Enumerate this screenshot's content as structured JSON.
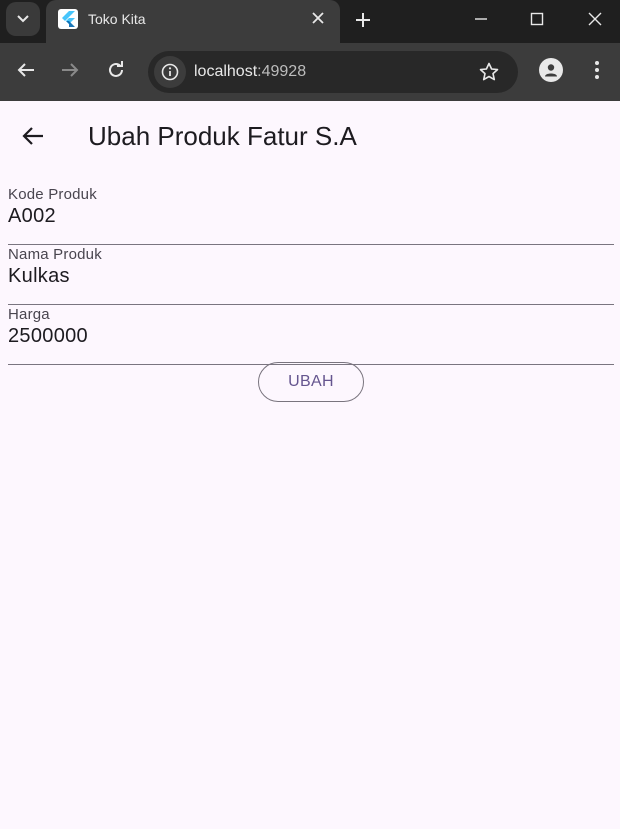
{
  "browser": {
    "tab_title": "Toko Kita",
    "url_host": "localhost",
    "url_port": ":49928"
  },
  "icons": {
    "tab_list": "chevron-down-icon",
    "favicon": "flutter-icon",
    "tab_close": "close-icon",
    "new_tab": "plus-icon",
    "back": "arrow-left-icon",
    "forward": "arrow-right-icon",
    "reload": "reload-icon",
    "site_info": "info-icon",
    "bookmark": "star-icon",
    "profile": "person-icon",
    "menu": "kebab-menu-icon"
  },
  "appbar": {
    "title": "Ubah Produk Fatur S.A"
  },
  "form": {
    "fields": [
      {
        "label": "Kode Produk",
        "value": "A002"
      },
      {
        "label": "Nama Produk",
        "value": "Kulkas"
      },
      {
        "label": "Harga",
        "value": "2500000"
      }
    ],
    "submit_label": "UBAH"
  },
  "colors": {
    "page_background": "#fdf7fe",
    "button_text": "#65558f",
    "chrome_dark": "#1f1f1f",
    "chrome_toolbar": "#3c3c3c"
  }
}
